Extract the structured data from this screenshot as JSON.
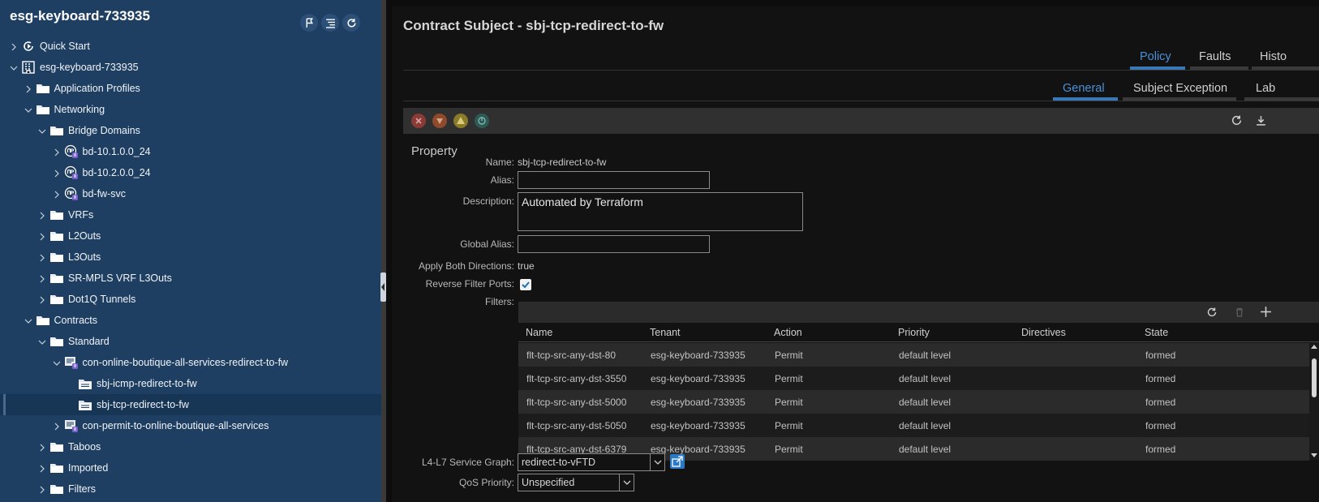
{
  "nav": {
    "title": "esg-keyboard-733935",
    "tree": [
      {
        "label": "Quick Start",
        "depth": 0,
        "icon": "quickstart-icon",
        "chevron": "right"
      },
      {
        "label": "esg-keyboard-733935",
        "depth": 0,
        "icon": "tenant-building-icon",
        "chevron": "down"
      },
      {
        "label": "Application Profiles",
        "depth": 1,
        "icon": "folder-icon",
        "chevron": "right"
      },
      {
        "label": "Networking",
        "depth": 1,
        "icon": "folder-icon",
        "chevron": "down"
      },
      {
        "label": "Bridge Domains",
        "depth": 2,
        "icon": "folder-icon",
        "chevron": "down"
      },
      {
        "label": "bd-10.1.0.0_24",
        "depth": 3,
        "icon": "bridge-domain-icon",
        "chevron": "right"
      },
      {
        "label": "bd-10.2.0.0_24",
        "depth": 3,
        "icon": "bridge-domain-icon",
        "chevron": "right"
      },
      {
        "label": "bd-fw-svc",
        "depth": 3,
        "icon": "bridge-domain-icon",
        "chevron": "right"
      },
      {
        "label": "VRFs",
        "depth": 2,
        "icon": "folder-icon",
        "chevron": "right"
      },
      {
        "label": "L2Outs",
        "depth": 2,
        "icon": "folder-icon",
        "chevron": "right"
      },
      {
        "label": "L3Outs",
        "depth": 2,
        "icon": "folder-icon",
        "chevron": "right"
      },
      {
        "label": "SR-MPLS VRF L3Outs",
        "depth": 2,
        "icon": "folder-icon",
        "chevron": "right"
      },
      {
        "label": "Dot1Q Tunnels",
        "depth": 2,
        "icon": "folder-icon",
        "chevron": "right"
      },
      {
        "label": "Contracts",
        "depth": 1,
        "icon": "folder-icon",
        "chevron": "down"
      },
      {
        "label": "Standard",
        "depth": 2,
        "icon": "folder-icon",
        "chevron": "down"
      },
      {
        "label": "con-online-boutique-all-services-redirect-to-fw",
        "depth": 3,
        "icon": "contract-icon",
        "chevron": "down"
      },
      {
        "label": "sbj-icmp-redirect-to-fw",
        "depth": 4,
        "icon": "subject-icon",
        "chevron": "none"
      },
      {
        "label": "sbj-tcp-redirect-to-fw",
        "depth": 4,
        "icon": "subject-icon",
        "chevron": "none",
        "selected": true
      },
      {
        "label": "con-permit-to-online-boutique-all-services",
        "depth": 3,
        "icon": "contract-icon",
        "chevron": "right"
      },
      {
        "label": "Taboos",
        "depth": 2,
        "icon": "folder-icon",
        "chevron": "right"
      },
      {
        "label": "Imported",
        "depth": 2,
        "icon": "folder-icon",
        "chevron": "right"
      },
      {
        "label": "Filters",
        "depth": 2,
        "icon": "folder-icon",
        "chevron": "right"
      }
    ]
  },
  "main": {
    "title": "Contract Subject - sbj-tcp-redirect-to-fw",
    "tabs": [
      "Policy",
      "Faults",
      "Histo"
    ],
    "active_tab": "Policy",
    "subtabs": [
      "General",
      "Subject Exception",
      "Lab"
    ],
    "active_subtab": "General",
    "section_title": "Property",
    "fields": {
      "name_label": "Name:",
      "name_value": "sbj-tcp-redirect-to-fw",
      "alias_label": "Alias:",
      "alias_value": "",
      "description_label": "Description:",
      "description_value": "Automated by Terraform",
      "global_alias_label": "Global Alias:",
      "global_alias_value": "",
      "apply_both_label": "Apply Both Directions:",
      "apply_both_value": "true",
      "reverse_ports_label": "Reverse Filter Ports:",
      "reverse_ports_checked": true,
      "filters_label": "Filters:",
      "service_graph_label": "L4-L7 Service Graph:",
      "service_graph_value": "redirect-to-vFTD",
      "qos_label": "QoS Priority:",
      "qos_value": "Unspecified"
    },
    "filters_table": {
      "columns": [
        "Name",
        "Tenant",
        "Action",
        "Priority",
        "Directives",
        "State"
      ],
      "rows": [
        [
          "flt-tcp-src-any-dst-80",
          "esg-keyboard-733935",
          "Permit",
          "default level",
          "",
          "formed"
        ],
        [
          "flt-tcp-src-any-dst-3550",
          "esg-keyboard-733935",
          "Permit",
          "default level",
          "",
          "formed"
        ],
        [
          "flt-tcp-src-any-dst-5000",
          "esg-keyboard-733935",
          "Permit",
          "default level",
          "",
          "formed"
        ],
        [
          "flt-tcp-src-any-dst-5050",
          "esg-keyboard-733935",
          "Permit",
          "default level",
          "",
          "formed"
        ],
        [
          "flt-tcp-src-any-dst-6379",
          "esg-keyboard-733935",
          "Permit",
          "default level",
          "",
          "formed"
        ]
      ]
    },
    "fault_colors": {
      "critical": "#8a3b36",
      "major": "#8f4a2c",
      "minor": "#8a7a2a",
      "warning": "#2e5a55"
    }
  }
}
